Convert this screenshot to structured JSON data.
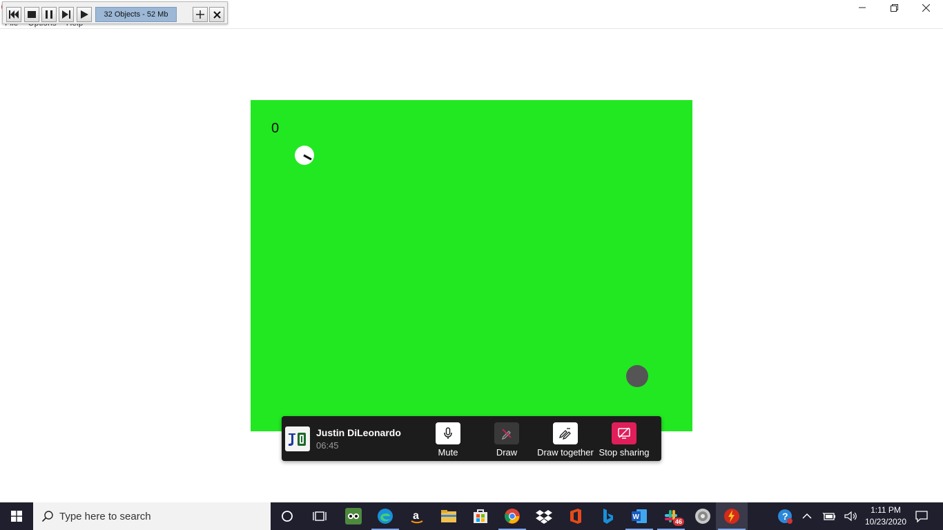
{
  "window": {
    "menu": [
      "File",
      "Options",
      "Help"
    ]
  },
  "recorder": {
    "status": "32 Objects - 52 Mb"
  },
  "game": {
    "score": "0",
    "background_color": "#22e822",
    "enemy_color": "#555555"
  },
  "share_bar": {
    "user_initials": "JD",
    "user_name": "Justin DiLeonardo",
    "timer": "06:45",
    "actions": {
      "mute": "Mute",
      "draw": "Draw",
      "draw_together": "Draw together",
      "stop_sharing": "Stop sharing"
    },
    "stop_color": "#e01e5a"
  },
  "taskbar": {
    "search_placeholder": "Type here to search",
    "apps": [
      "cortana-icon",
      "task-view-icon",
      "tripadvisor-icon",
      "edge-icon",
      "amazon-icon",
      "file-explorer-icon",
      "store-icon",
      "chrome-icon",
      "dropbox-icon",
      "office-icon",
      "bing-icon",
      "word-icon",
      "slack-icon",
      "disk-utility-icon",
      "flash-app-icon"
    ],
    "slack_badge": "46",
    "clock_time": "1:11 PM",
    "clock_date": "10/23/2020"
  }
}
